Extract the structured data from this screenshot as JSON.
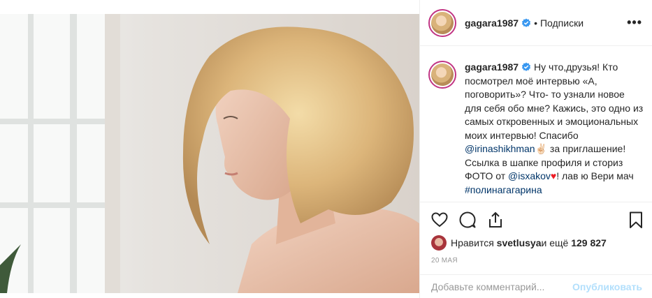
{
  "post": {
    "author": "gagara1987",
    "header_separator": "•",
    "follow_label": "Подписки",
    "more_label": "•••",
    "caption": {
      "username": "gagara1987",
      "line1": " Ну что,друзья! Кто посмотрел моё интервью «А, поговорить»? Что- то узнали новое для себя обо мне? Кажись, это одно из самых откровенных и эмоциональных моих интервью! Спасибо ",
      "mention1": "@irinashikhman",
      "emoji_hand": "✌🏻",
      "line2": " за приглашение! Ссылка в шапке профиля и сториз ФОТО от ",
      "mention2": "@isxakov",
      "emoji_heart": "♥",
      "line3": "! лав ю Вери мач ",
      "hashtag": "#полинагагарина"
    },
    "likes": {
      "prefix": "Нравится ",
      "user": "svetlusya",
      "middle": " и ещё ",
      "count": "129 827"
    },
    "date": "20 мая",
    "comment": {
      "placeholder": "Добавьте комментарий...",
      "publish_label": "Опубликовать"
    },
    "icons": {
      "like": "heart-icon",
      "comment": "comment-icon",
      "share": "share-icon",
      "save": "bookmark-icon",
      "verified": "verified-badge-icon"
    },
    "colors": {
      "link": "#003569",
      "verified": "#3897f0",
      "publish_disabled": "#b2dffc",
      "story_ring": "#c13584"
    }
  }
}
